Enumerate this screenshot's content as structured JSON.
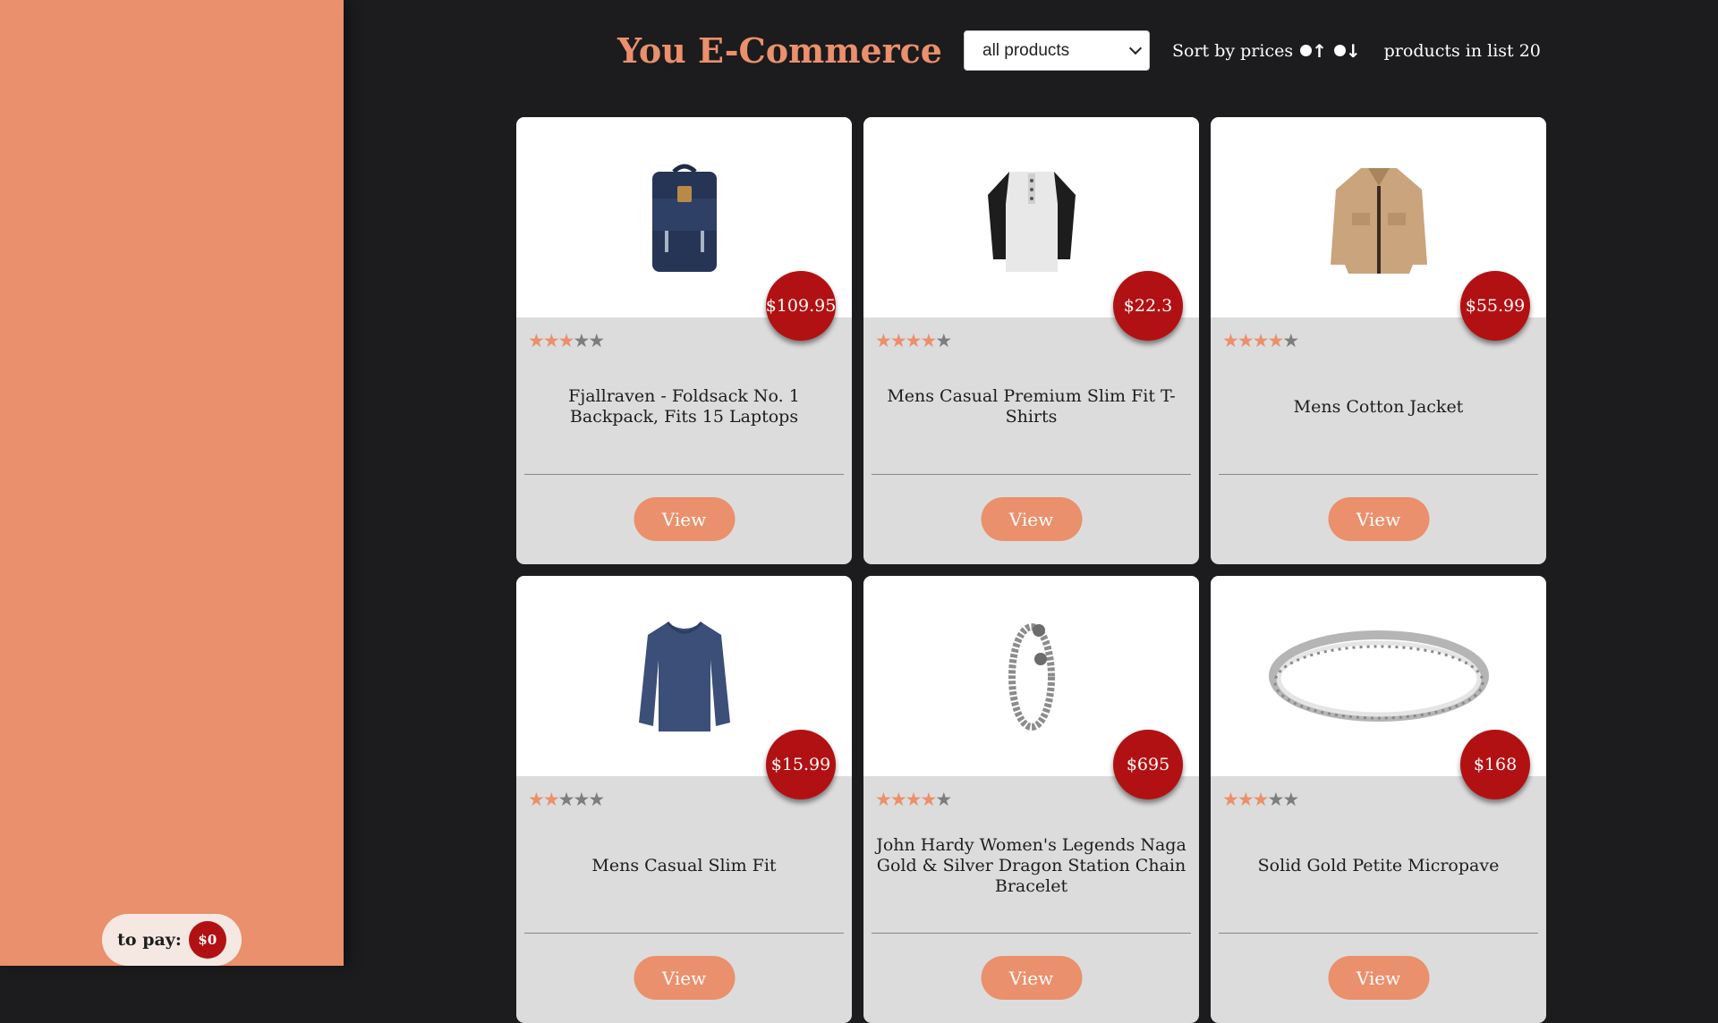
{
  "header": {
    "title": "You E-Commerce",
    "category_select": "all products",
    "sort_label": "Sort by prices",
    "count_text": "products in list 20"
  },
  "cart": {
    "label": "to pay:",
    "amount": "$0"
  },
  "colors": {
    "accent": "#ea906c",
    "price_badge": "#b21113",
    "background": "#1c1b1d",
    "card": "#dcdcdc"
  },
  "products": [
    {
      "name": "Fjallraven - Foldsack No. 1 Backpack, Fits 15 Laptops",
      "price": "$109.95",
      "rating": 3,
      "button": "View",
      "icon": "backpack"
    },
    {
      "name": "Mens Casual Premium Slim Fit T-Shirts",
      "price": "$22.3",
      "rating": 4,
      "button": "View",
      "icon": "tshirt"
    },
    {
      "name": "Mens Cotton Jacket",
      "price": "$55.99",
      "rating": 4,
      "button": "View",
      "icon": "jacket"
    },
    {
      "name": "Mens Casual Slim Fit",
      "price": "$15.99",
      "rating": 2,
      "button": "View",
      "icon": "longsleeve"
    },
    {
      "name": "John Hardy Women's Legends Naga Gold & Silver Dragon Station Chain Bracelet",
      "price": "$695",
      "rating": 4,
      "button": "View",
      "icon": "bracelet"
    },
    {
      "name": "Solid Gold Petite Micropave",
      "price": "$168",
      "rating": 3,
      "button": "View",
      "icon": "ring"
    }
  ]
}
